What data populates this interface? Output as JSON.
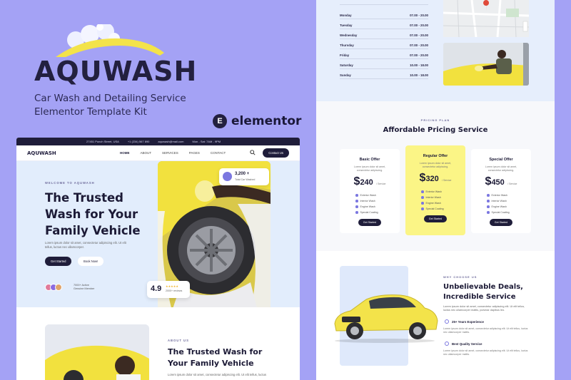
{
  "brand": {
    "name": "AQUWASH",
    "tagline_line1": "Car Wash and Detailing Service",
    "tagline_line2": "Elementor Template Kit",
    "builder_name": "elementor",
    "builder_badge": "E",
    "colors": {
      "background": "#a4a2f5",
      "dark": "#1f1d3a",
      "accent_yellow": "#f3e34a",
      "light_blue": "#e2edfc"
    }
  },
  "site": {
    "topbar": {
      "address": "27451 Punch Street, USA",
      "phone": "+1 (234) 567 890",
      "email": "aquwash@mail.com",
      "hours": "Mon - Sat: 7AM - 9PM"
    },
    "nav": {
      "logo": "AQUWASH",
      "items": [
        "HOME",
        "ABOUT",
        "SERVICES",
        "PAGES",
        "CONTACT"
      ],
      "cta": "Contact Us"
    },
    "hero": {
      "eyebrow": "WELCOME TO AQUWASH",
      "title_line1": "The Trusted",
      "title_line2": "Wash for Your",
      "title_line3": "Family Vehicle",
      "description": "Lorem ipsum dolor sit amet, consectetur adipiscing elit. Ut elit tellus, luctus nec ullamcorper.",
      "btn_primary": "Get Started",
      "btn_secondary": "Book Now!",
      "members_count": "7000+ Active",
      "members_label": "Genuine Member",
      "washed_count": "3,200 +",
      "washed_label": "Total Car Washed",
      "rating": "4.9",
      "rating_label": "2000+ reviews"
    },
    "about": {
      "eyebrow": "ABOUT US",
      "title_line1": "The Trusted Wash for",
      "title_line2": "Your Family Vehicle",
      "description": "Lorem ipsum dolor sit amet, consectetur adipiscing elit. Ut elit tellus, luctus"
    }
  },
  "site2": {
    "hours": [
      {
        "day": "Monday",
        "time": "07.00 - 20.00"
      },
      {
        "day": "Tuesday",
        "time": "07.00 - 20.00"
      },
      {
        "day": "Wednesday",
        "time": "07.00 - 20.00"
      },
      {
        "day": "Thursday",
        "time": "07.00 - 20.00"
      },
      {
        "day": "Friday",
        "time": "07.00 - 20.00"
      },
      {
        "day": "Saturday",
        "time": "10.00 - 18.00"
      },
      {
        "day": "Sunday",
        "time": "10.00 - 18.00"
      }
    ],
    "pricing": {
      "eyebrow": "PRICING PLAN",
      "title": "Affordable Pricing Service",
      "plans": [
        {
          "name": "Basic Offer",
          "desc": "Lorem ipsum dolor sit amet, consectetur adipiscing.",
          "price": "240",
          "per": "/ Service",
          "features": [
            "Exterior Wash",
            "Interior Wash",
            "Engine Wash",
            "Special Coating"
          ],
          "cta": "Get Started"
        },
        {
          "name": "Regular Offer",
          "desc": "Lorem ipsum dolor sit amet, consectetur adipiscing.",
          "price": "320",
          "per": "/ Service",
          "features": [
            "Exterior Wash",
            "Interior Wash",
            "Engine Wash",
            "Special Coating"
          ],
          "cta": "Get Started"
        },
        {
          "name": "Special Offer",
          "desc": "Lorem ipsum dolor sit amet, consectetur adipiscing.",
          "price": "450",
          "per": "/ Service",
          "features": [
            "Exterior Wash",
            "Interior Wash",
            "Engine Wash",
            "Special Coating"
          ],
          "cta": "Get Started"
        }
      ]
    },
    "why": {
      "eyebrow": "WHY CHOOSE US",
      "title_line1": "Unbelievable Deals,",
      "title_line2": "Incredible Service",
      "description": "Lorem ipsum dolor sit amet, consectetur adipiscing elit. Ut elit tellus, luctus nec ullamcorper mattis, pulvinar dapibus leo.",
      "feature1_title": "25+ Years Experience",
      "feature1_desc": "Lorem ipsum dolor sit amet, consectetur adipiscing elit. Ut elit tellus, luctus nec ullamcorper mattis.",
      "feature2_title": "Best Quality Service",
      "feature2_desc": "Lorem ipsum dolor sit amet, consectetur adipiscing elit. Ut elit tellus, luctus nec ullamcorper mattis."
    }
  }
}
